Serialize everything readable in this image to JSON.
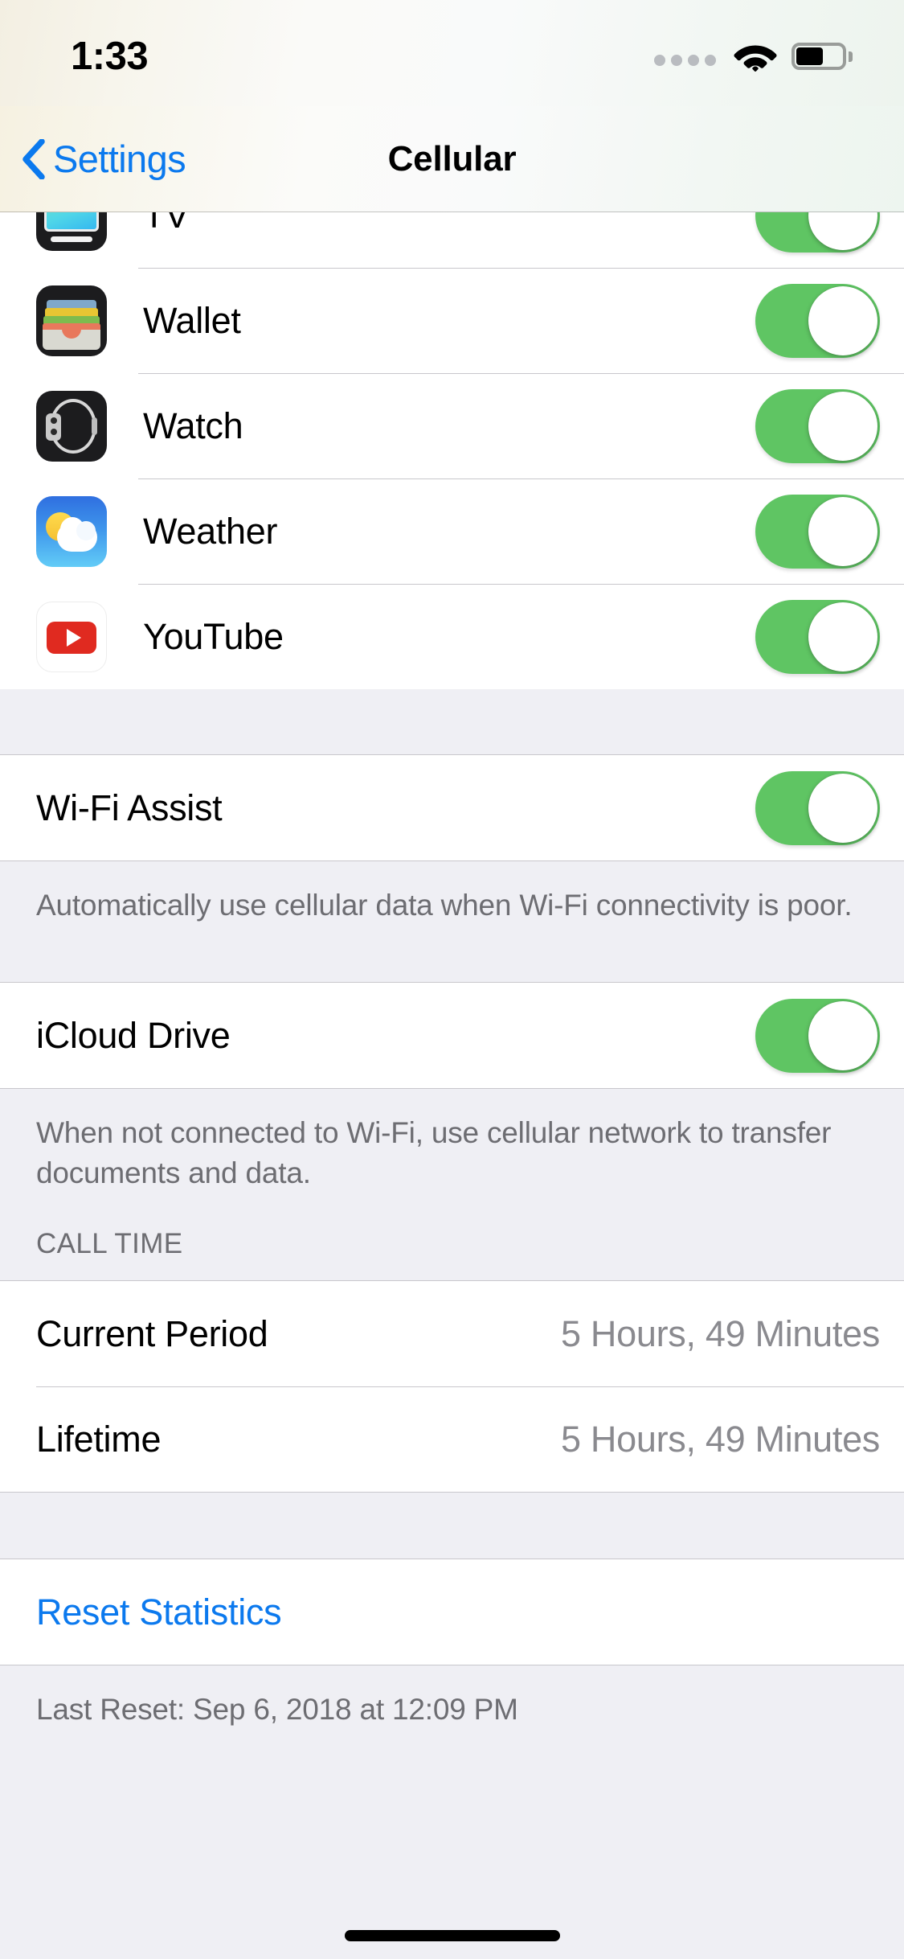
{
  "status_bar": {
    "time": "1:33",
    "signal_dots": 4,
    "wifi_icon": "wifi-icon",
    "battery_icon": "battery-icon",
    "battery_level_percent": 48
  },
  "nav_bar": {
    "back_label": "Settings",
    "back_icon": "chevron-left-icon",
    "title": "Cellular",
    "accent_color": "#0B79EE"
  },
  "colors": {
    "toggle_on": "#5FC563",
    "link": "#0B79EE",
    "group_background": "#FFFFFF",
    "page_background": "#EFEFF4",
    "separator": "#C8C7CC",
    "secondary_text": "#8A8A8F",
    "footnote_text": "#6D6D72"
  },
  "app_list": [
    {
      "name": "TV",
      "icon": "tv-app-icon",
      "toggle": "on",
      "clipped": true
    },
    {
      "name": "Wallet",
      "icon": "wallet-app-icon",
      "toggle": "on",
      "clipped": false
    },
    {
      "name": "Watch",
      "icon": "watch-app-icon",
      "toggle": "on",
      "clipped": false
    },
    {
      "name": "Weather",
      "icon": "weather-app-icon",
      "toggle": "on",
      "clipped": false
    },
    {
      "name": "YouTube",
      "icon": "youtube-app-icon",
      "toggle": "on",
      "clipped": false
    }
  ],
  "wifi_assist": {
    "label": "Wi-Fi Assist",
    "toggle": "on",
    "footnote": "Automatically use cellular data when Wi-Fi connectivity is poor."
  },
  "icloud_drive": {
    "label": "iCloud Drive",
    "toggle": "on",
    "footnote": "When not connected to Wi-Fi, use cellular network to transfer documents and data."
  },
  "call_time": {
    "header": "CALL TIME",
    "rows": [
      {
        "label": "Current Period",
        "value": "5 Hours, 49 Minutes"
      },
      {
        "label": "Lifetime",
        "value": "5 Hours, 49 Minutes"
      }
    ]
  },
  "reset": {
    "label": "Reset Statistics",
    "footnote": "Last Reset: Sep 6, 2018 at 12:09 PM"
  },
  "home_indicator": "home-indicator"
}
